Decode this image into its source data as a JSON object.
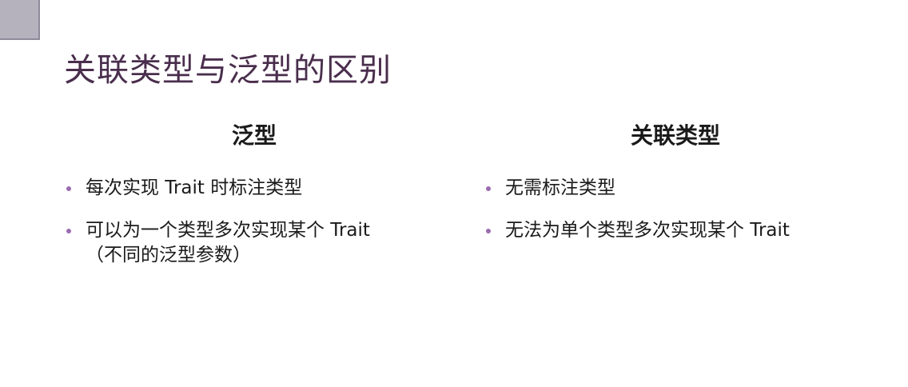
{
  "title": "关联类型与泛型的区别",
  "left": {
    "heading": "泛型",
    "bullets": [
      {
        "line1": "每次实现 Trait 时标注类型",
        "line2": ""
      },
      {
        "line1": "可以为一个类型多次实现某个 Trait",
        "line2": "（不同的泛型参数）"
      }
    ]
  },
  "right": {
    "heading": "关联类型",
    "bullets": [
      {
        "line1": "无需标注类型",
        "line2": ""
      },
      {
        "line1": "无法为单个类型多次实现某个 Trait",
        "line2": ""
      }
    ]
  },
  "colors": {
    "title": "#4a2e4d",
    "bullet": "#9b6bb0",
    "corner": "#b5b1bd"
  }
}
